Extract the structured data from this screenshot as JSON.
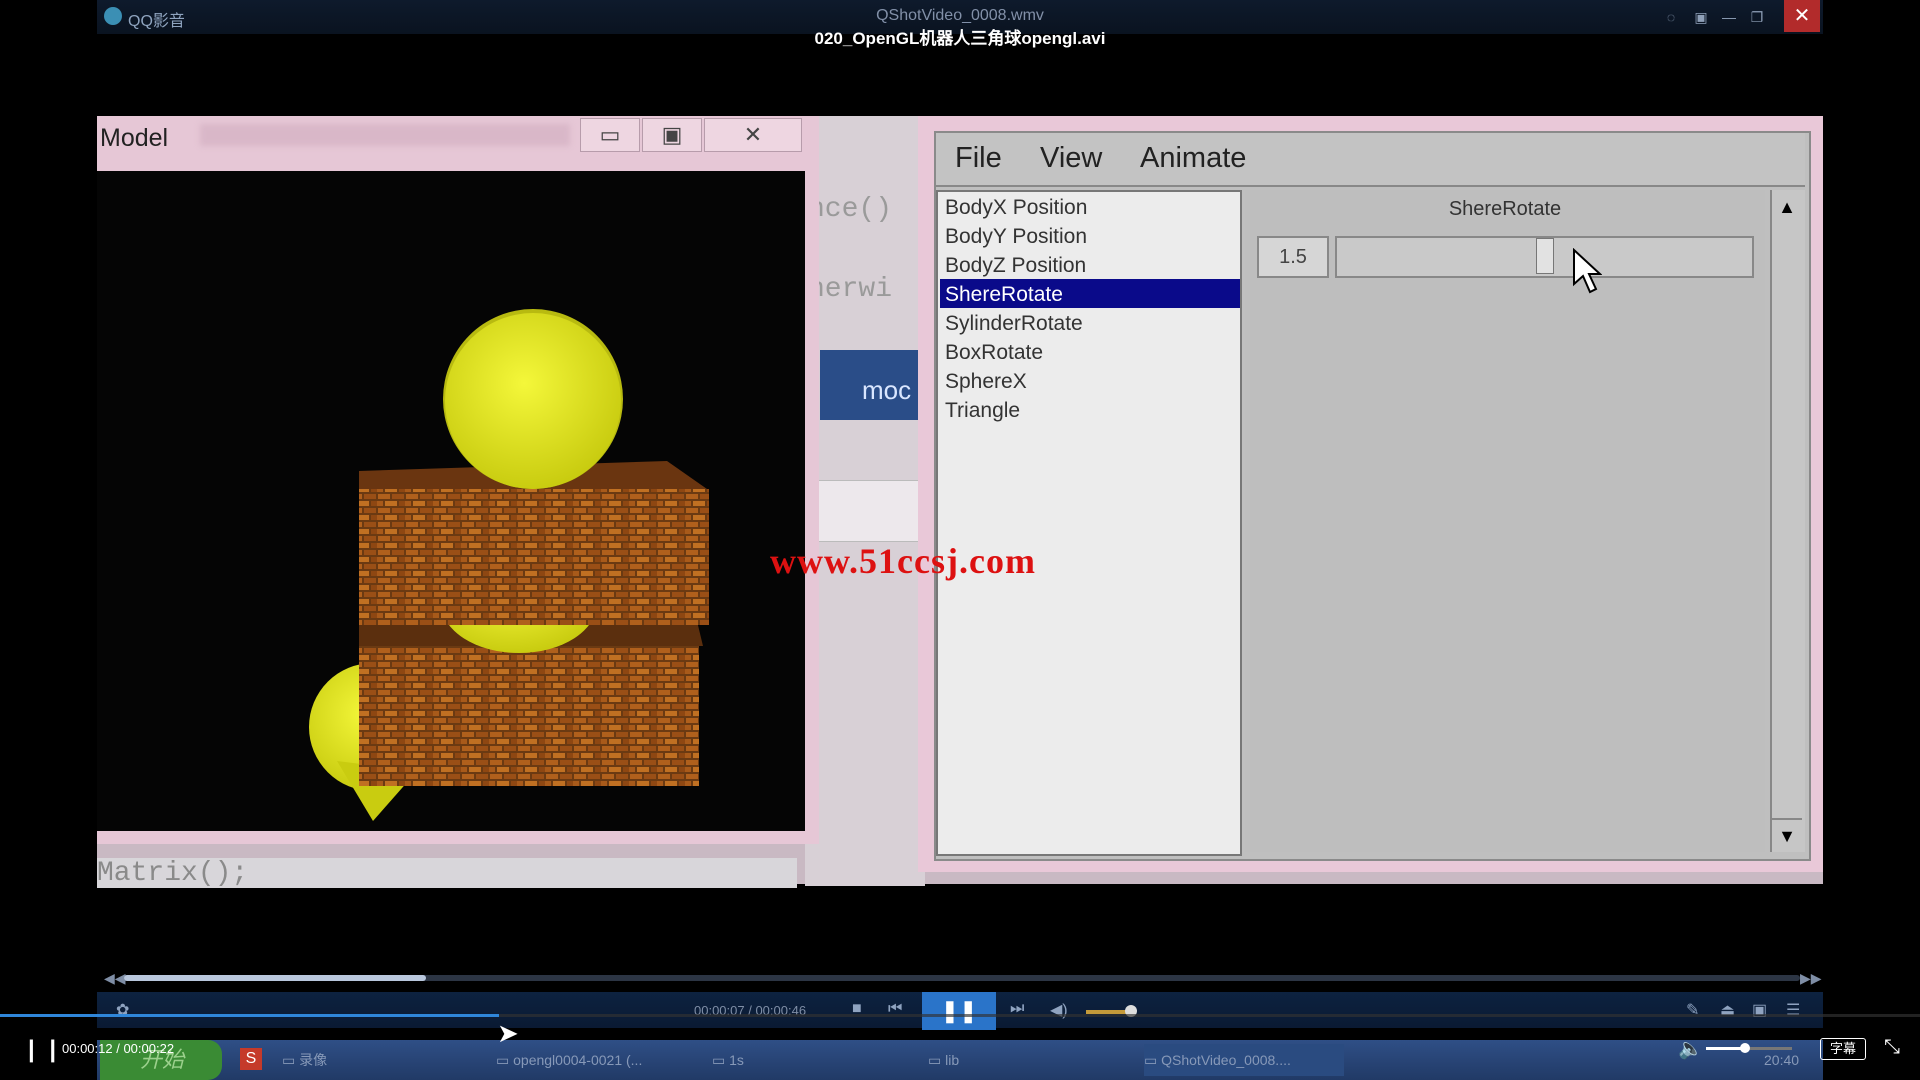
{
  "player": {
    "video_title": "020_OpenGL机器人三角球opengl.avi",
    "current_time": "00:00:12 / 00:00:22",
    "progress_fraction": 0.26,
    "volume_fraction": 0.45,
    "subtitle_label": "字幕"
  },
  "inner_player": {
    "app_title": "QQ影音",
    "file_title": "QShotVideo_0008.wmv",
    "time": "00:00:07 / 00:00:46",
    "seek_fraction": 0.18,
    "volume_fraction": 0.8
  },
  "model_window": {
    "title": "Model"
  },
  "code": {
    "line1": "nce()",
    "line2": "nerwi",
    "button": "moc",
    "matrix": "Matrix();"
  },
  "dialog": {
    "menu": [
      "File",
      "View",
      "Animate"
    ],
    "list": [
      "BodyX Position",
      "BodyY Position",
      "BodyZ Position",
      "ShereRotate",
      "SylinderRotate",
      "BoxRotate",
      "SphereX",
      "Triangle"
    ],
    "selected_index": 3,
    "slider_title": "ShereRotate",
    "slider_value": "1.5"
  },
  "watermark": "www.51ccsj.com",
  "taskbar": {
    "start": "开始",
    "items": [
      "录像",
      "opengl0004-0021 (...",
      "1s",
      "lib",
      "QShotVideo_0008...."
    ],
    "clock": "20:40"
  },
  "colors": {
    "accent": "#2f86d9",
    "selection": "#0a0a8a",
    "watermark": "#dd1111",
    "sphere": "#e8ee1c"
  }
}
